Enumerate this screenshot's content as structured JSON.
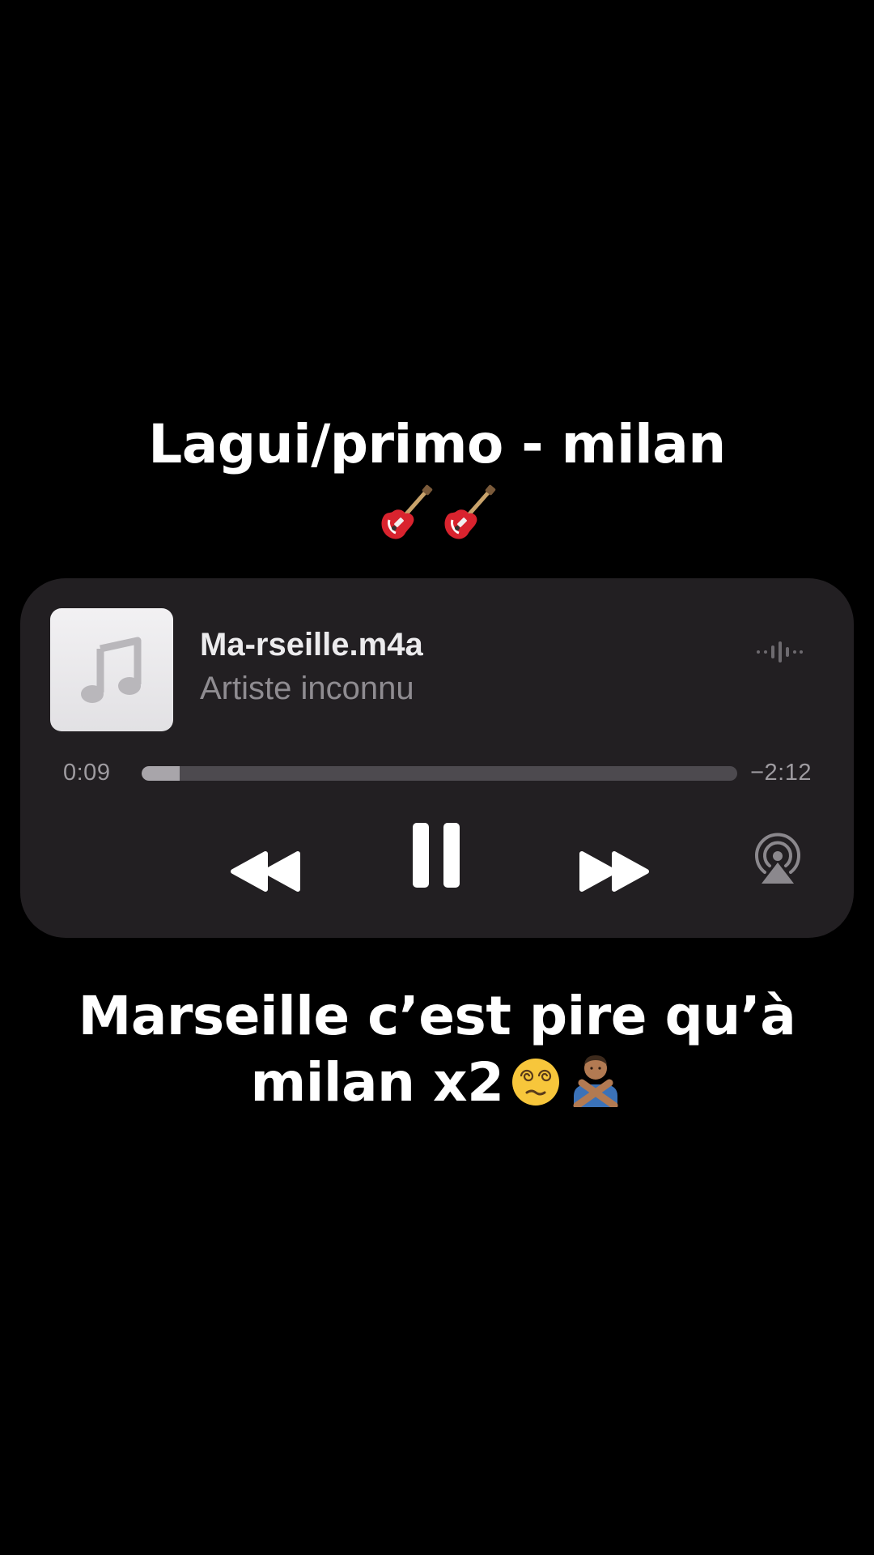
{
  "captions": {
    "top": "Lagui/primo - milan",
    "bottom_line1": "Marseille c’est pire qu’à",
    "bottom_line2": "milan x2"
  },
  "emojis": {
    "top_row": [
      "guitar-emoji",
      "guitar-emoji"
    ],
    "bottom_line": [
      "face-with-spiral-eyes-emoji",
      "person-gesturing-no-emoji"
    ]
  },
  "player": {
    "title": "Ma-rseille.m4a",
    "artist": "Artiste inconnu",
    "elapsed": "0:09",
    "remaining": "−2:12",
    "progress": 0.064,
    "artwork_icon": "music-note-icon",
    "controls": [
      "rewind-icon",
      "pause-icon",
      "fast-forward-icon",
      "airplay-icon"
    ],
    "waveform_icon": "waveform-icon"
  },
  "colors": {
    "background": "#000000",
    "card": "#221f22",
    "title": "#ecebed",
    "secondary": "#8f8c91",
    "progress_fill": "#a8a5aa",
    "progress_track": "#4d4a4f",
    "controls": "#ffffff",
    "airplay": "#8b888d"
  }
}
